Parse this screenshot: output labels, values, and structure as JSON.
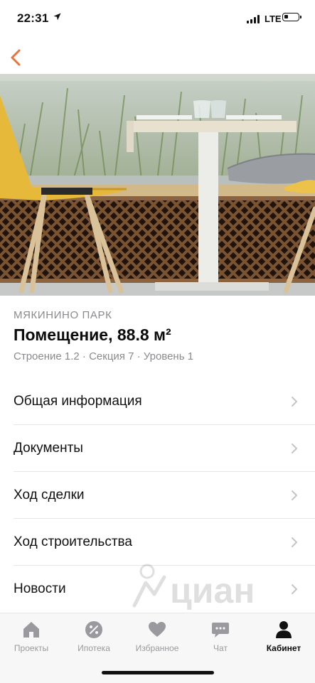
{
  "status": {
    "time": "22:31",
    "network": "LTE"
  },
  "colors": {
    "accent": "#e8743b",
    "muted": "#8a8a8e",
    "tab_inactive": "#9a9a9e"
  },
  "header": {
    "complex": "МЯКИНИНО ПАРК",
    "title": "Помещение, 88.8 м²",
    "subtitle": "Строение 1.2 · Секция 7 · Уровень 1"
  },
  "menu": [
    {
      "label": "Общая информация"
    },
    {
      "label": "Документы"
    },
    {
      "label": "Ход сделки"
    },
    {
      "label": "Ход строительства"
    },
    {
      "label": "Новости"
    }
  ],
  "watermark": "циан",
  "tabs": [
    {
      "label": "Проекты",
      "icon": "home-icon"
    },
    {
      "label": "Ипотека",
      "icon": "percent-icon"
    },
    {
      "label": "Избранное",
      "icon": "heart-icon"
    },
    {
      "label": "Чат",
      "icon": "chat-icon"
    },
    {
      "label": "Кабинет",
      "icon": "user-icon",
      "active": true
    }
  ]
}
